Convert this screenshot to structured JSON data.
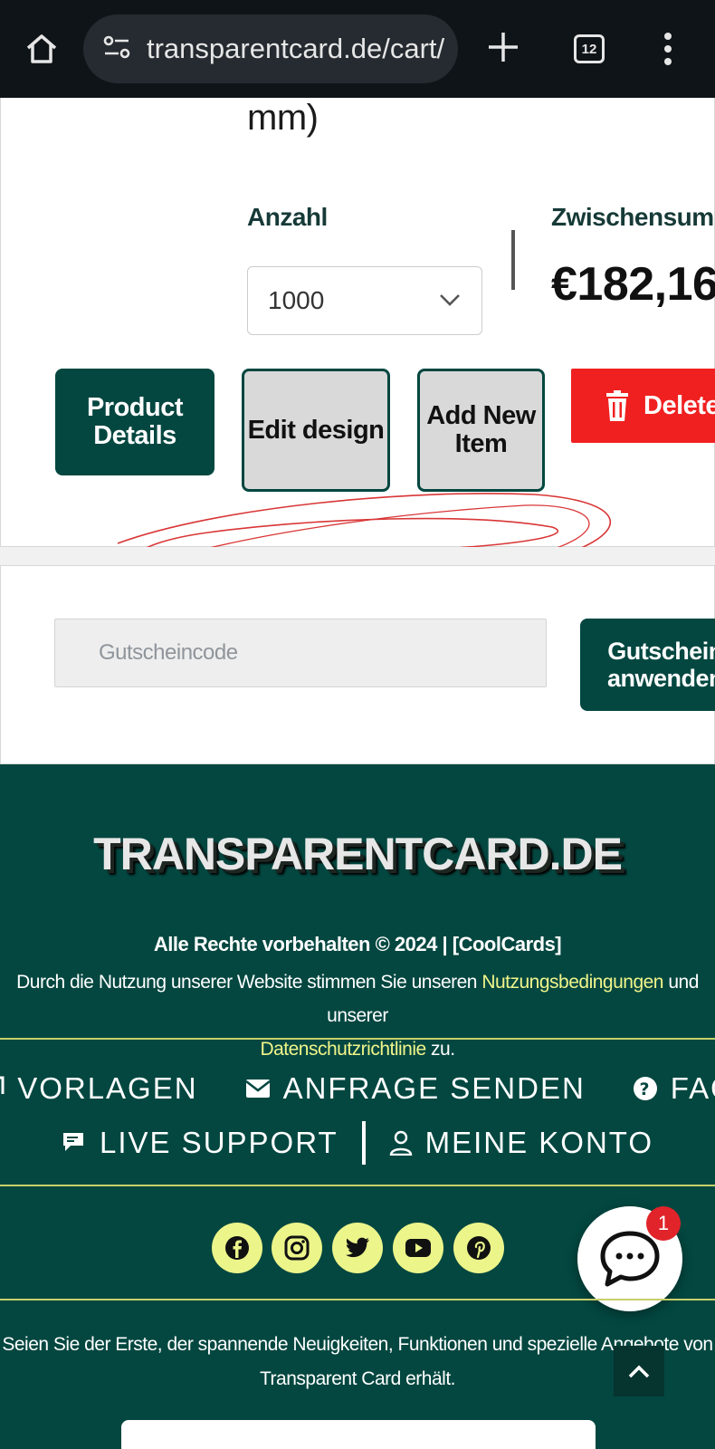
{
  "browser": {
    "url": "transparentcard.de/cart/",
    "tab_count": "12"
  },
  "cart": {
    "unit_tail": "mm)",
    "quantity_label": "Anzahl",
    "quantity_value": "1000",
    "subtotal_label": "Zwischensumme",
    "subtotal_value": "€182,16",
    "details_button": "Product Details",
    "edit_button": "Edit design",
    "add_button": "Add New Item",
    "delete_button": "Delete"
  },
  "coupon": {
    "placeholder": "Gutscheincode",
    "button": "Gutschein anwenden"
  },
  "footer": {
    "brand": "TRANSPARENTCARD.DE",
    "rights": "Alle Rechte vorbehalten © 2024 | [CoolCards]",
    "usage_before": "Durch die Nutzung unserer Website stimmen Sie unseren ",
    "terms_link": "Nutzungsbedingungen",
    "usage_middle": " und unserer",
    "privacy_link": "Datenschutzrichtlinie",
    "usage_after": " zu.",
    "nav": {
      "templates": "VORLAGEN",
      "request": "ANFRAGE SENDEN",
      "faq": "FAQ",
      "support": "LIVE SUPPORT",
      "account": "MEINE KONTO"
    },
    "social_icons": [
      "facebook-icon",
      "instagram-icon",
      "twitter-icon",
      "youtube-icon",
      "pinterest-icon"
    ],
    "chat_badge": "1",
    "newsletter_line1": "Seien Sie der Erste, der spannende Neuigkeiten, Funktionen und spezielle Angebote von",
    "newsletter_line2": "Transparent Card erhält."
  },
  "colors": {
    "brand_green": "#034740",
    "delete_red": "#f02020",
    "accent_yellow": "#ecf58a"
  }
}
